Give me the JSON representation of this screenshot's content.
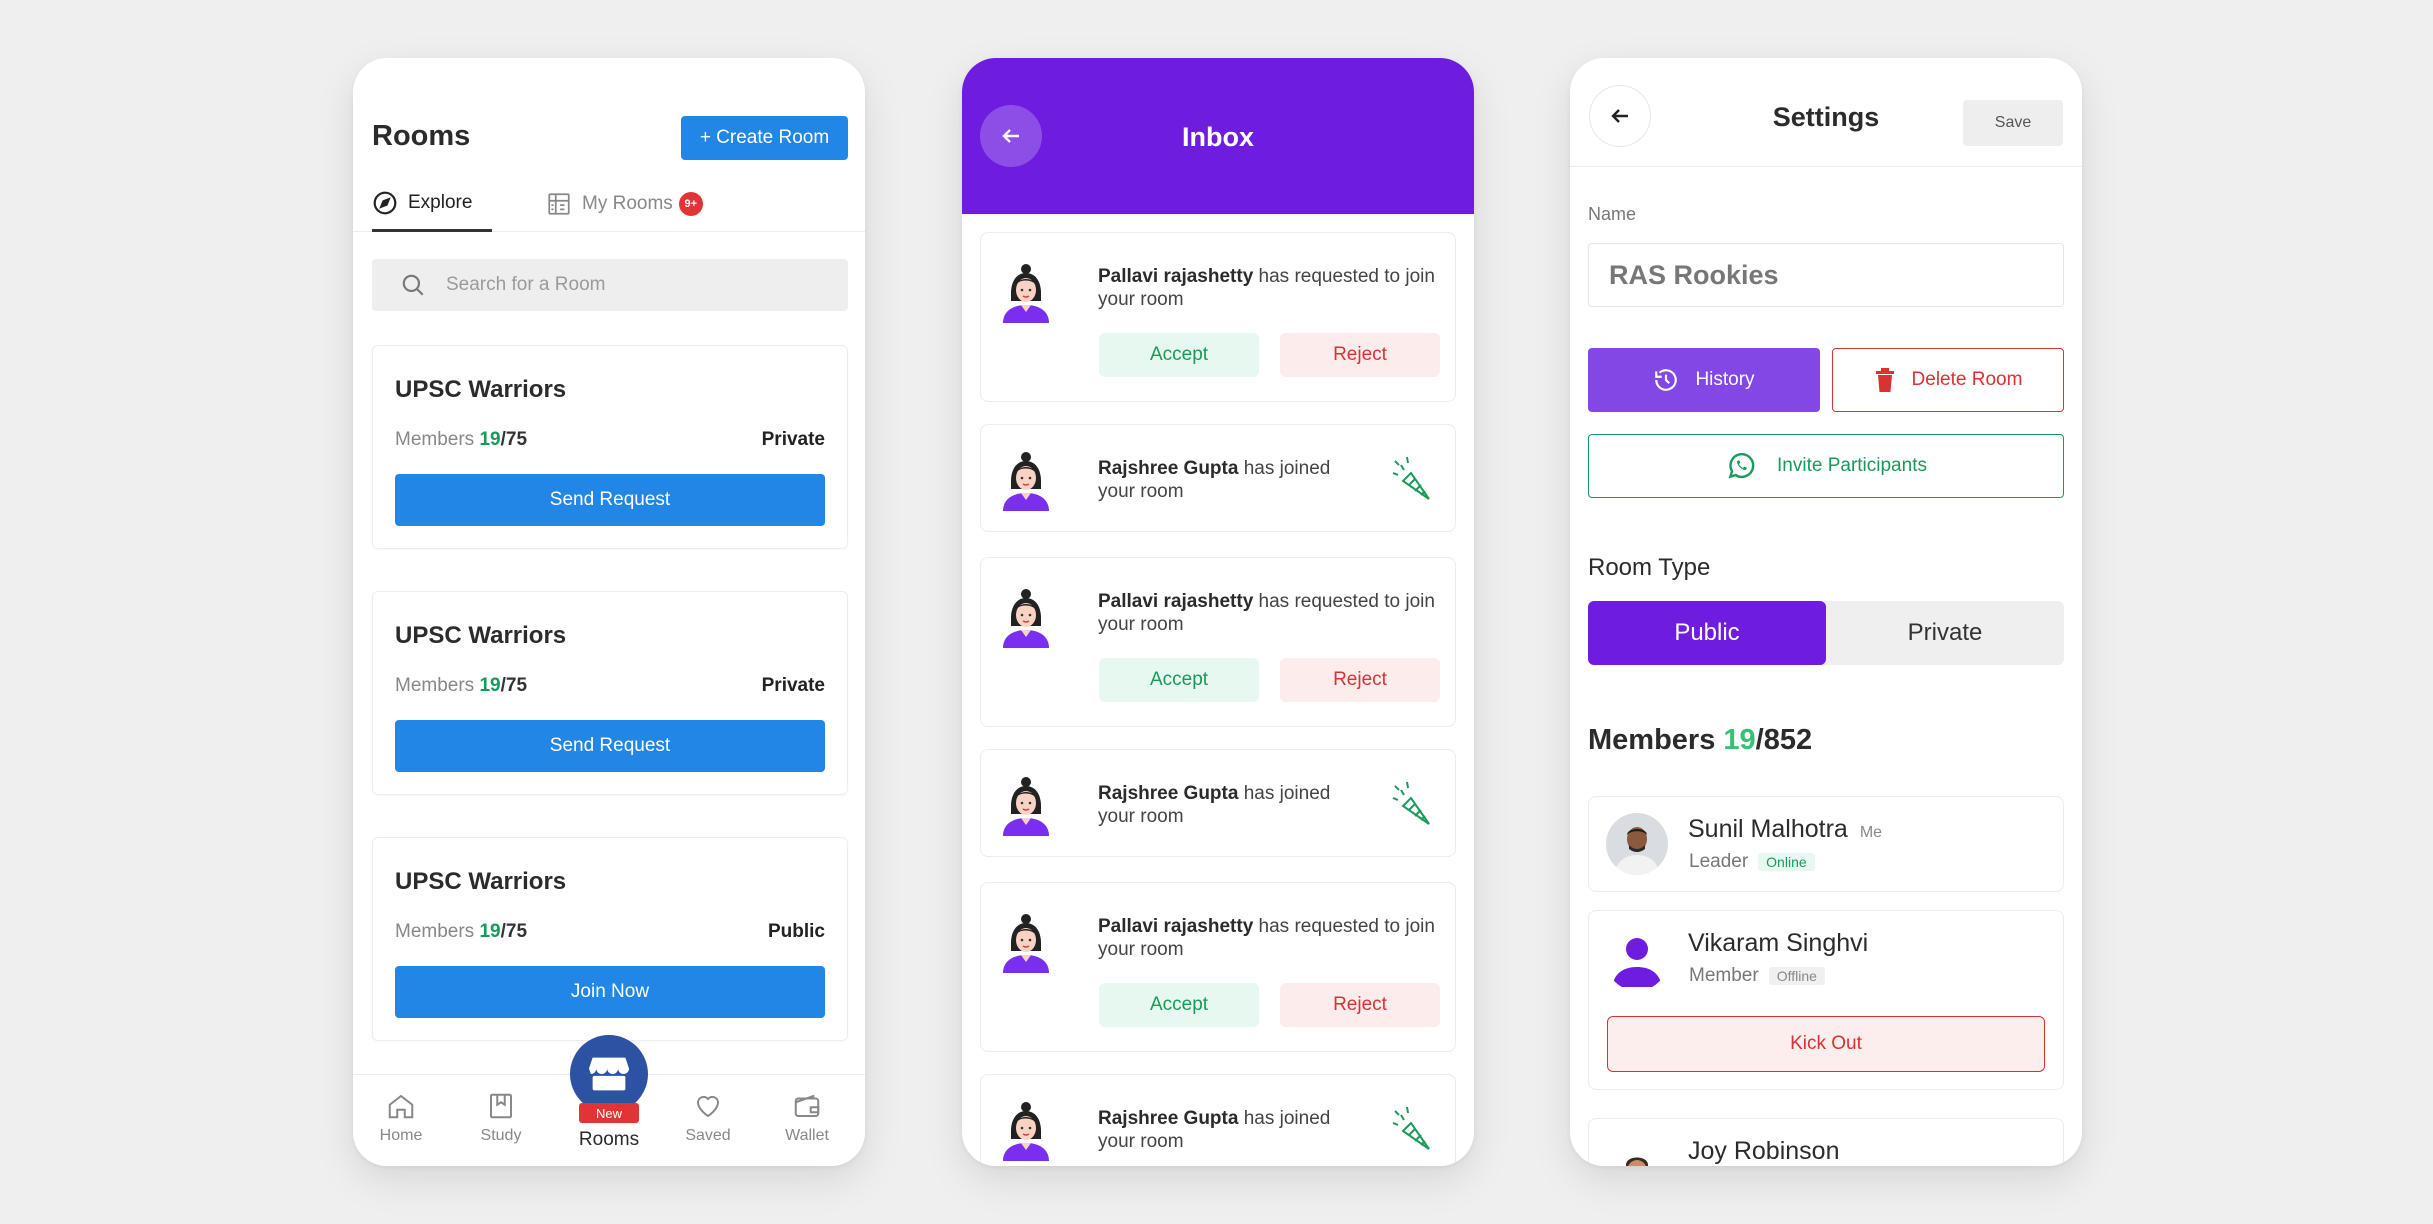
{
  "rooms_screen": {
    "title": "Rooms",
    "create_button": "+ Create Room",
    "tabs": [
      {
        "label": "Explore",
        "active": true
      },
      {
        "label": "My Rooms",
        "badge": "9+"
      }
    ],
    "search": {
      "placeholder": "Search for a Room",
      "value": ""
    },
    "rooms": [
      {
        "name": "UPSC Warriors",
        "members_label": "Members",
        "members_current": "19",
        "members_total": "/75",
        "privacy": "Private",
        "action": "Send Request"
      },
      {
        "name": "UPSC Warriors",
        "members_label": "Members",
        "members_current": "19",
        "members_total": "/75",
        "privacy": "Private",
        "action": "Send Request"
      },
      {
        "name": "UPSC Warriors",
        "members_label": "Members",
        "members_current": "19",
        "members_total": "/75",
        "privacy": "Public",
        "action": "Join Now"
      }
    ],
    "bottom_nav": {
      "home": "Home",
      "study": "Study",
      "rooms": "Rooms",
      "rooms_badge": "New",
      "saved": "Saved",
      "wallet": "Wallet"
    },
    "accent_color": "#2186e6"
  },
  "inbox_screen": {
    "title": "Inbox",
    "notifications": [
      {
        "type": "request",
        "user": "Pallavi rajashetty",
        "message": "has requested to join your room",
        "accept": "Accept",
        "reject": "Reject"
      },
      {
        "type": "joined",
        "user": "Rajshree Gupta",
        "message": "has joined your room"
      },
      {
        "type": "request",
        "user": "Pallavi rajashetty",
        "message": "has requested to join your room",
        "accept": "Accept",
        "reject": "Reject"
      },
      {
        "type": "joined",
        "user": "Rajshree Gupta",
        "message": "has joined your room"
      },
      {
        "type": "request",
        "user": "Pallavi rajashetty",
        "message": "has requested to join your room",
        "accept": "Accept",
        "reject": "Reject"
      },
      {
        "type": "joined",
        "user": "Rajshree Gupta",
        "message": "has joined your room"
      }
    ],
    "header_color": "#6e1de0"
  },
  "settings_screen": {
    "title": "Settings",
    "save_button": "Save",
    "name_label": "Name",
    "name_value": "RAS Rookies",
    "history_button": "History",
    "delete_button": "Delete Room",
    "invite_button": "Invite Participants",
    "room_type_label": "Room Type",
    "room_type_options": [
      "Public",
      "Private"
    ],
    "room_type_selected": "Public",
    "members_heading": "Members",
    "members_current": "19",
    "members_total": "/852",
    "members": [
      {
        "name": "Sunil Malhotra",
        "tag": "Me",
        "role": "Leader",
        "status": "Online"
      },
      {
        "name": "Vikaram Singhvi",
        "role": "Member",
        "status": "Offline",
        "action": "Kick Out"
      },
      {
        "name": "Joy Robinson"
      }
    ]
  }
}
